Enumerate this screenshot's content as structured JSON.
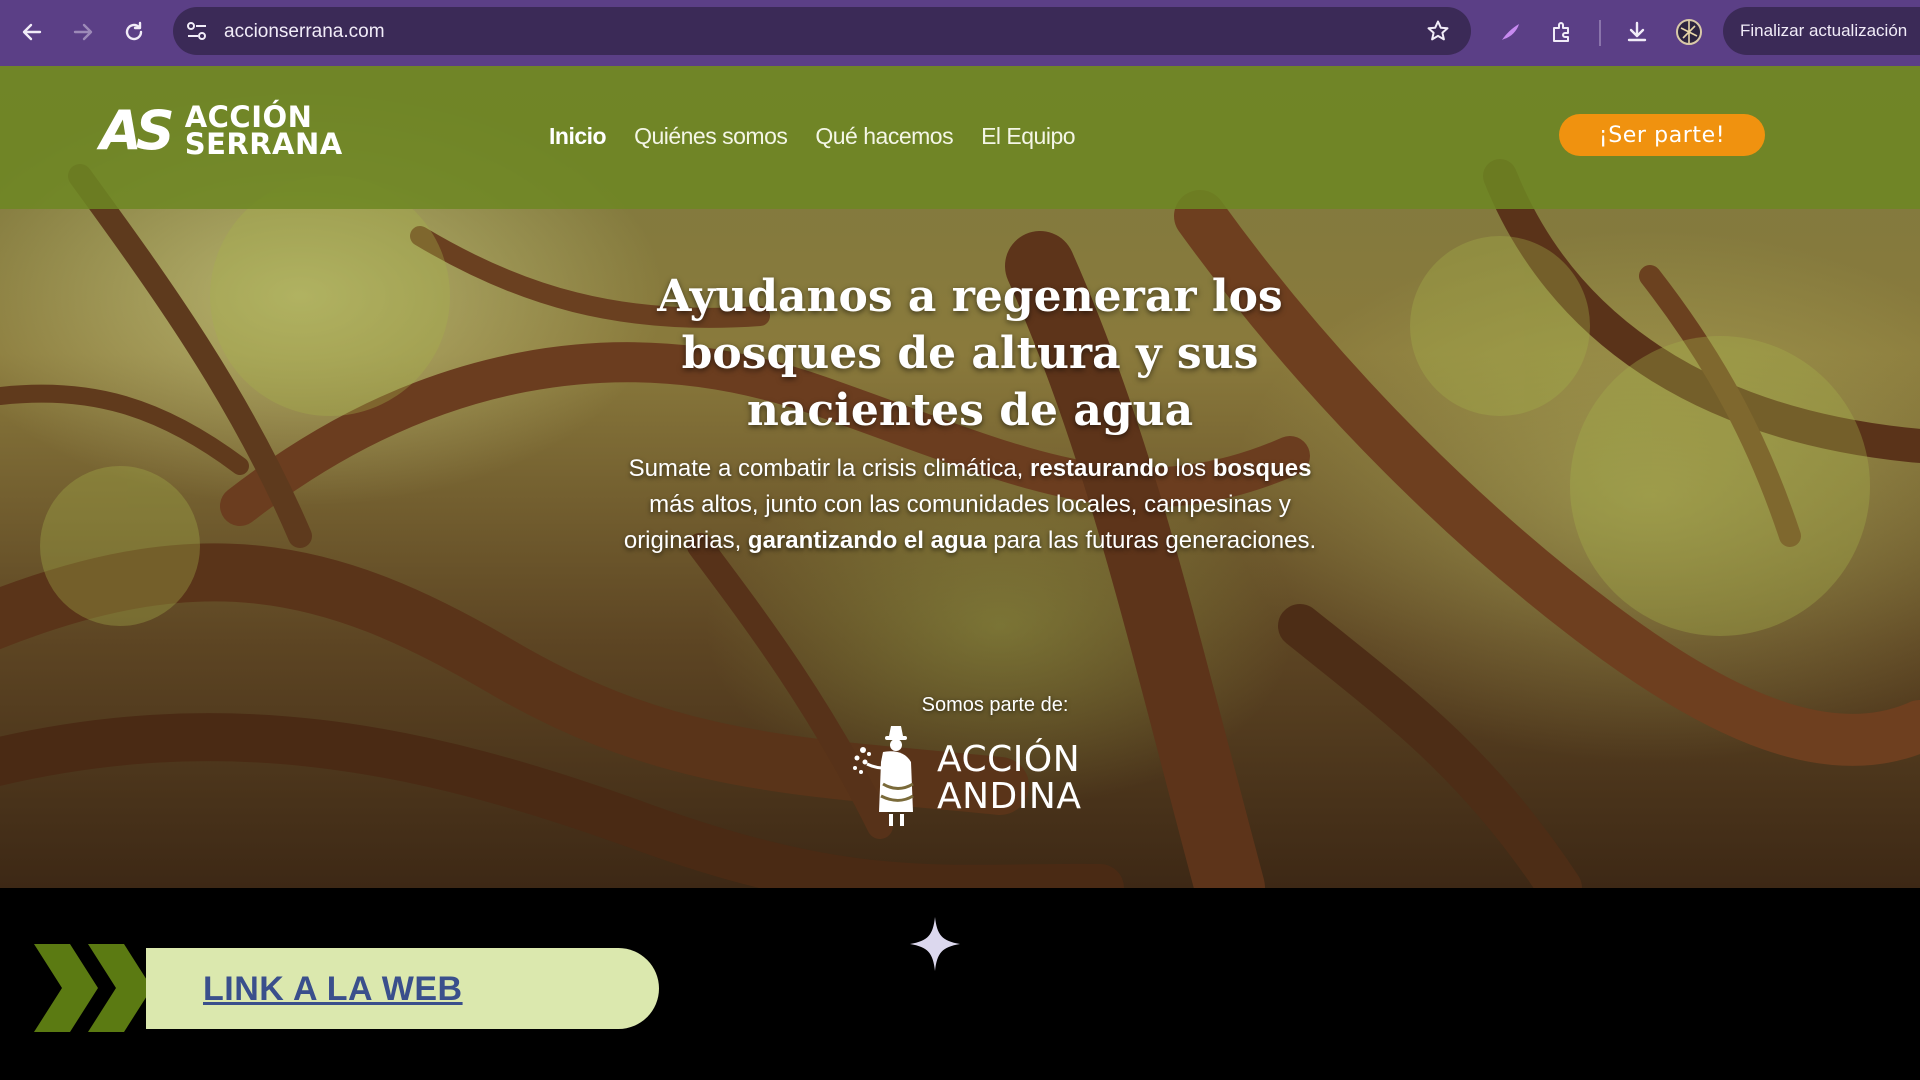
{
  "browser": {
    "url": "accionserrana.com",
    "update_label": "Finalizar actualización"
  },
  "site": {
    "brand": {
      "mark": "AS",
      "line1": "ACCIÓN",
      "line2": "SERRANA"
    },
    "menu": [
      {
        "label": "Inicio"
      },
      {
        "label": "Quiénes somos"
      },
      {
        "label": "Qué hacemos"
      },
      {
        "label": "El Equipo"
      }
    ],
    "cta_label": "¡Ser parte!",
    "hero": {
      "title_part1": "Ayudanos a regenerar los ",
      "title_bold": "bosques de altura",
      "title_part2": " y sus nacientes de agua",
      "sub_part1": "Sumate a combatir la crisis climática, ",
      "sub_bold1": "restaurando",
      "sub_part2": " los ",
      "sub_bold2": "bosques",
      "sub_part3": " más altos, junto con las comunidades locales, campesinas y originarias, ",
      "sub_bold3": "garantizando el agua",
      "sub_part4": " para las futuras generaciones."
    },
    "partof_label": "Somos parte de:",
    "partner": {
      "line1": "ACCIÓN",
      "line2": "ANDINA"
    }
  },
  "banner": {
    "link_label": "LINK A LA WEB"
  },
  "colors": {
    "browser_frame": "#5b3f86",
    "header_green": "#6e8723",
    "cta_orange": "#f0920f",
    "link_pill": "#dbe8ae",
    "link_text": "#3a4f8c",
    "chevron_green": "#5b7a12"
  }
}
